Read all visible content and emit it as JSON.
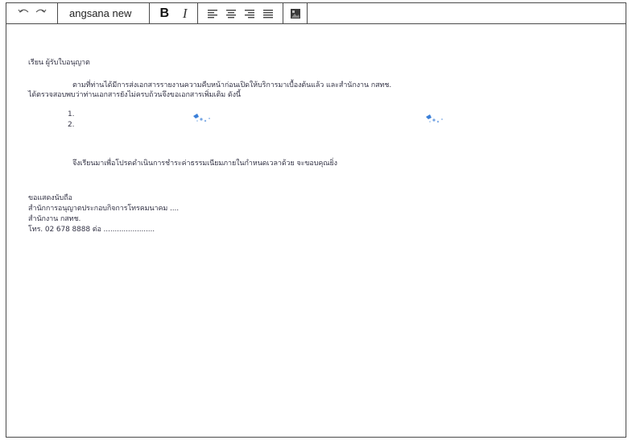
{
  "toolbar": {
    "undo_icon": "undo-arrow-icon",
    "redo_icon": "redo-arrow-icon",
    "font_name": "angsana new",
    "bold_label": "B",
    "italic_label": "I",
    "align_icons": [
      "align-left-icon",
      "align-center-icon",
      "align-right-icon",
      "align-justify-icon"
    ],
    "image_icon": "insert-image-icon"
  },
  "letter": {
    "salutation": "เรียน ผู้รับใบอนุญาต",
    "paragraph_1": "ตามที่ท่านได้มีการส่งเอกสารรายงานความคืบหน้าก่อนเปิดให้บริการมาเบื้องต้นแล้ว และสำนักงาน กสทช.",
    "paragraph_2": "ได้ตรวจสอบพบว่าท่านเอกสารยังไม่ครบถ้วนจึงขอเอกสารเพิ่มเติม ดังนี้",
    "list_items": [
      "1.",
      "2."
    ],
    "closing_request": "จึงเรียนมาเพื่อโปรดดำเนินการชำระค่าธรรมเนียมภายในกำหนดเวลาด้วย จะขอบคุณยิ่ง",
    "sign_off": "ขอแสดงนับถือ",
    "department": "สำนักการอนุญาตประกอบกิจการโทรคมนาคม ....",
    "office": "สำนักงาน กสทช.",
    "phone": "โทร. 02 678 8888 ต่อ ......................."
  },
  "colors": {
    "border": "#4a4a4a",
    "text": "#343446",
    "blot": "#3a7fd8"
  }
}
